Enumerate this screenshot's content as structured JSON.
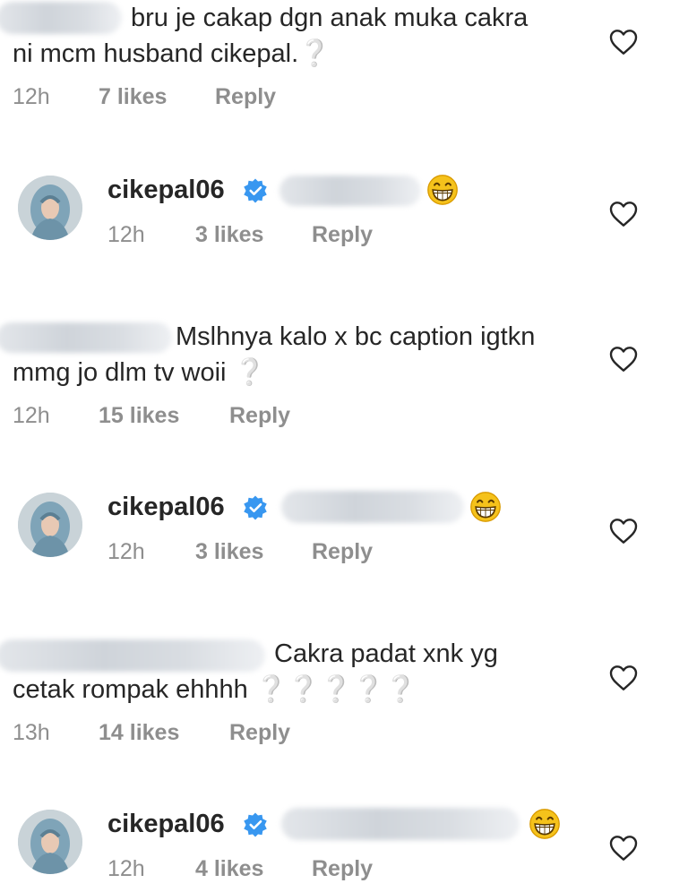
{
  "comments": [
    {
      "line1": "bru je cakap dgn anak muka cakra",
      "line2": "ni mcm husband cikepal.❔",
      "time": "12h",
      "likes": "7 likes",
      "reply": "Reply"
    },
    {
      "username": "cikepal06",
      "time": "12h",
      "likes": "3 likes",
      "reply": "Reply"
    },
    {
      "line1": "Mslhnya kalo x bc caption igtkn",
      "line2": "mmg jo dlm tv woii ❔",
      "time": "12h",
      "likes": "15 likes",
      "reply": "Reply"
    },
    {
      "username": "cikepal06",
      "time": "12h",
      "likes": "3 likes",
      "reply": "Reply"
    },
    {
      "line1": "Cakra padat xnk yg",
      "line2": "cetak rompak ehhhh ❔❔❔❔❔",
      "time": "13h",
      "likes": "14 likes",
      "reply": "Reply"
    },
    {
      "username": "cikepal06",
      "time": "12h",
      "likes": "4 likes",
      "reply": "Reply"
    }
  ],
  "icons": {
    "like": "heart-outline-icon",
    "verified": "verified-badge-icon",
    "emoji": "grinning-face-emoji"
  },
  "colors": {
    "text": "#262626",
    "meta": "#8e8e8e",
    "verified": "#3897f0",
    "emoji": "#f5c21b"
  }
}
